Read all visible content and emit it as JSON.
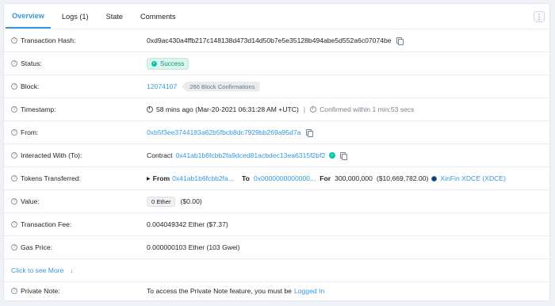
{
  "tabs": [
    {
      "label": "Overview",
      "active": true
    },
    {
      "label": "Logs (1)",
      "active": false
    },
    {
      "label": "State",
      "active": false
    },
    {
      "label": "Comments",
      "active": false
    }
  ],
  "more_icon": "vertical-dots",
  "rows": {
    "tx_hash": {
      "label": "Transaction Hash:",
      "value": "0xd9ac430a4ffb217c148138d473d14d50b7e5e35128b494abe5d552a6c07074be"
    },
    "status": {
      "label": "Status:",
      "value": "Success"
    },
    "block": {
      "label": "Block:",
      "value": "12074107",
      "confirmations": "266 Block Confirmations"
    },
    "timestamp": {
      "label": "Timestamp:",
      "value": "58 mins ago (Mar-20-2021 06:31:28 AM +UTC)",
      "sep": "|",
      "confirmed": "Confirmed within 1 min:53 secs"
    },
    "from": {
      "label": "From:",
      "value": "0xb5f3ee3744183a62b5fbcb8dc7929bb269a95d7a"
    },
    "interacted": {
      "label": "Interacted With (To):",
      "prefix": "Contract",
      "value": "0x41ab1b6fcbb2fa9dced81acbdec13ea6315f2bf2"
    },
    "tokens": {
      "label": "Tokens Transferred:",
      "from_label": "From",
      "from_value": "0x41ab1b6fcbb2fa...",
      "to_label": "To",
      "to_value": "0x0000000000000...",
      "for_label": "For",
      "amount": "300,000,000",
      "usd": "($10,669,782.00)",
      "token_name": "XinFin XDCE (XDCE)"
    },
    "value": {
      "label": "Value:",
      "ether_badge": "0 Ether",
      "usd": "($0.00)"
    },
    "fee": {
      "label": "Transaction Fee:",
      "value": "0.004049342 Ether ($7.37)"
    },
    "gas": {
      "label": "Gas Price:",
      "value": "0.000000103 Ether (103 Gwei)"
    },
    "see_more": {
      "label": "Click to see More"
    },
    "note": {
      "label": "Private Note:",
      "text": "To access the Private Note feature, you must be",
      "link": "Logged In"
    }
  },
  "colors": {
    "accent": "#3498db",
    "success": "#00a186",
    "border": "#e7eaf3"
  }
}
